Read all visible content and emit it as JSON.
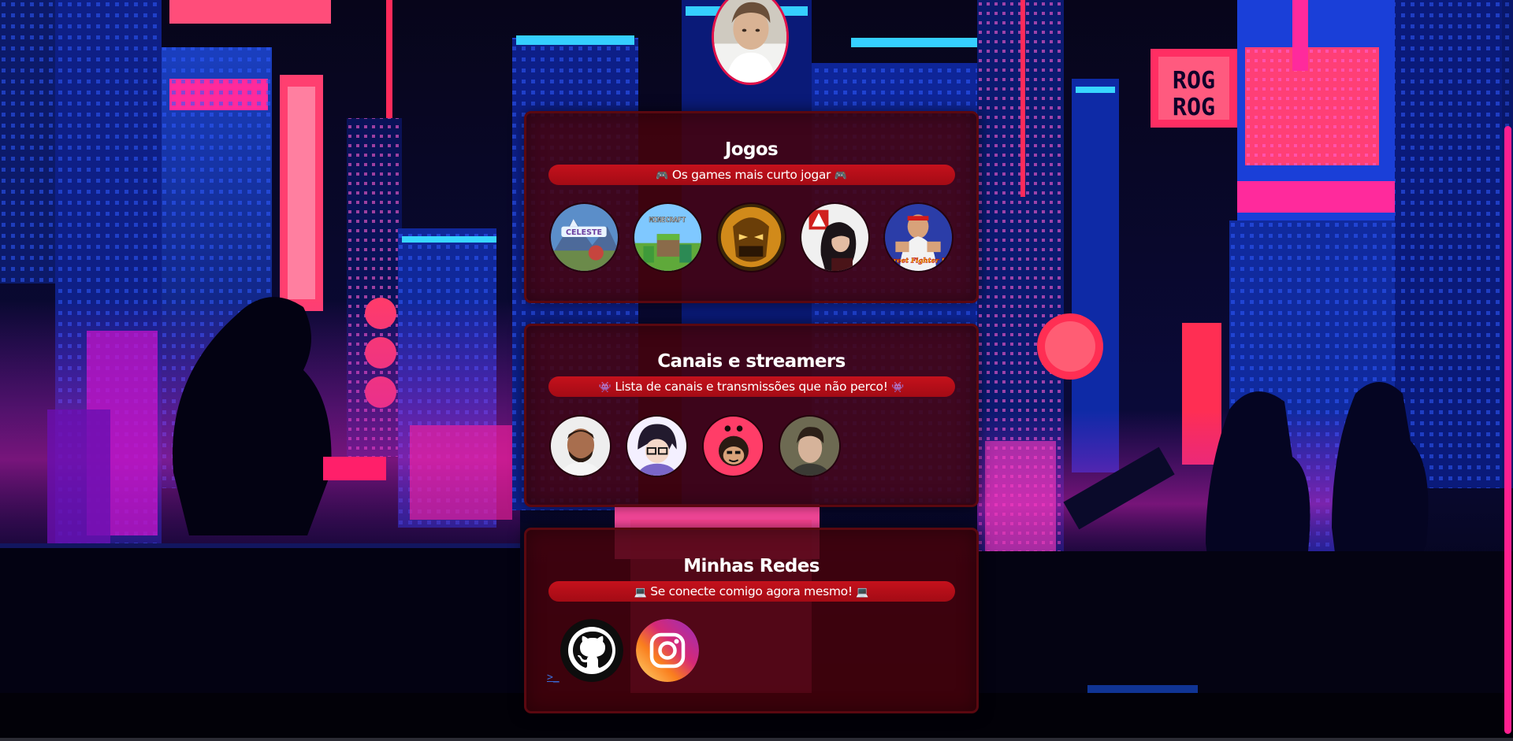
{
  "profile": {
    "icon": "profile-photo"
  },
  "sections": {
    "jogos": {
      "title": "Jogos",
      "emoji": "🎮",
      "subtitle": "Os games mais curto jogar",
      "items": [
        {
          "label": "CELESTE",
          "icon": "celeste-cover"
        },
        {
          "label": "MINECRAFT",
          "icon": "minecraft-cover"
        },
        {
          "label": "",
          "icon": "mortal-kombat-cover"
        },
        {
          "label": "",
          "icon": "apex-legends-cover"
        },
        {
          "label": "Street Fighter III",
          "icon": "street-fighter-cover"
        }
      ]
    },
    "canais": {
      "title": "Canais e streamers",
      "emoji": "👾",
      "subtitle": "Lista de canais e transmissões que não perco!",
      "items": [
        {
          "icon": "streamer-1-avatar"
        },
        {
          "icon": "streamer-2-avatar"
        },
        {
          "icon": "streamer-3-avatar"
        },
        {
          "icon": "streamer-4-avatar"
        }
      ]
    },
    "redes": {
      "title": "Minhas Redes",
      "emoji": "💻",
      "subtitle": "Se conecte comigo agora mesmo!",
      "items": [
        {
          "icon": "github-icon"
        },
        {
          "icon": "instagram-icon"
        }
      ],
      "terminal_mark": ">_"
    }
  },
  "colors": {
    "card_bg": "#46020c",
    "pill": "#c5111c",
    "accent_pink": "#ff1f8f",
    "profile_border": "#e0114a"
  }
}
